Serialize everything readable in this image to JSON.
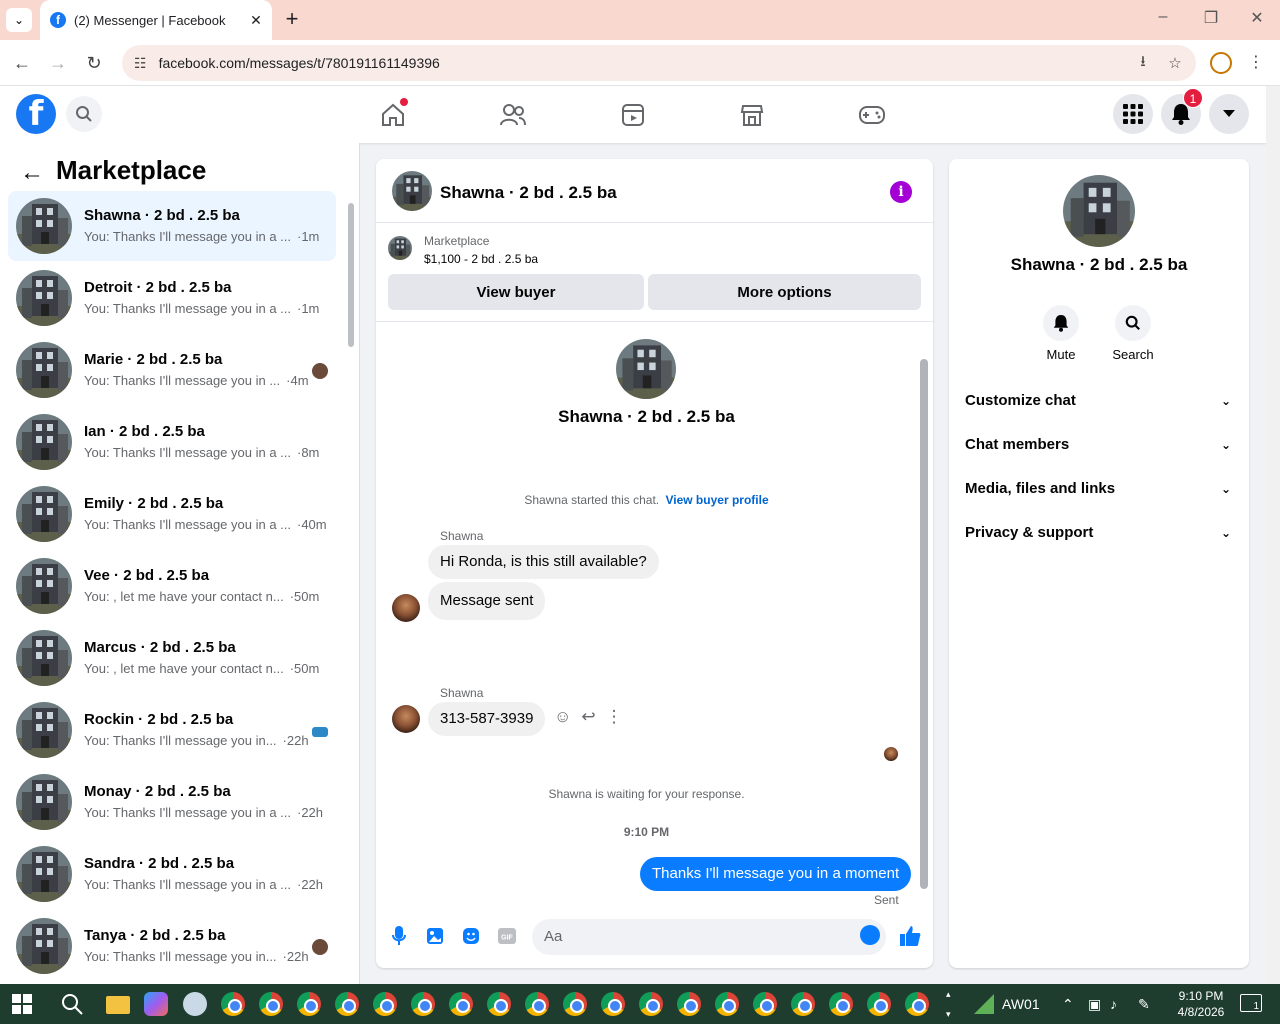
{
  "browser": {
    "tab_title": "(2) Messenger | Facebook",
    "favicon_letter": "f",
    "url": "facebook.com/messages/t/780191161149396"
  },
  "header": {
    "notification_count": "1",
    "logo_letter": "f"
  },
  "sidebar": {
    "title": "Marketplace",
    "conversations": [
      {
        "name": "Shawna · 2 bd . 2.5 ba",
        "snippet": "You: Thanks I'll message you in a ...",
        "time": "·1m",
        "active": true
      },
      {
        "name": "Detroit · 2 bd . 2.5 ba",
        "snippet": "You: Thanks I'll message you in a ...",
        "time": "·1m"
      },
      {
        "name": "Marie · 2 bd . 2.5 ba",
        "snippet": "You: Thanks I'll message you in ...",
        "time": "·4m"
      },
      {
        "name": "Ian · 2 bd . 2.5 ba",
        "snippet": "You: Thanks I'll message you in a ...",
        "time": "·8m"
      },
      {
        "name": "Emily · 2 bd . 2.5 ba",
        "snippet": "You: Thanks I'll message you in a ...",
        "time": "·40m"
      },
      {
        "name": "Vee · 2 bd . 2.5 ba",
        "snippet": "You: , let me have your contact n...",
        "time": "·50m"
      },
      {
        "name": "Marcus · 2 bd . 2.5 ba",
        "snippet": "You: , let me have your contact n...",
        "time": "·50m"
      },
      {
        "name": "Rockin · 2 bd . 2.5 ba",
        "snippet": "You: Thanks I'll message you in...",
        "time": "·22h"
      },
      {
        "name": "Monay · 2 bd . 2.5 ba",
        "snippet": "You: Thanks I'll message you in a ...",
        "time": "·22h"
      },
      {
        "name": "Sandra · 2 bd . 2.5 ba",
        "snippet": "You: Thanks I'll message you in a ...",
        "time": "·22h"
      },
      {
        "name": "Tanya · 2 bd . 2.5 ba",
        "snippet": "You: Thanks I'll message you in...",
        "time": "·22h"
      }
    ]
  },
  "chat": {
    "title": "Shawna · 2 bd . 2.5 ba",
    "info_letter": "i",
    "marketplace_label": "Marketplace",
    "listing": "$1,100 - 2 bd . 2.5 ba",
    "view_buyer": "View buyer",
    "more_options": "More options",
    "started_text": "Shawna started this chat.",
    "view_buyer_profile": "View buyer profile",
    "sender1": "Shawna",
    "msg1": "Hi Ronda, is this still available?",
    "msg2": "Message sent",
    "sender2": "Shawna",
    "msg3": "313-587-3939",
    "waiting": "Shawna is waiting for your response.",
    "timestamp": "9:10 PM",
    "my_msg": "Thanks I'll message you in a moment",
    "sent_status": "Sent",
    "input_placeholder": "Aa"
  },
  "details": {
    "name": "Shawna · 2 bd . 2.5 ba",
    "mute_label": "Mute",
    "search_label": "Search",
    "rows": [
      "Customize chat",
      "Chat members",
      "Media, files and links",
      "Privacy & support"
    ]
  },
  "taskbar": {
    "network_label": "AW01",
    "time": "9:10 PM",
    "date": "4/8/2026",
    "notif_count": "1"
  },
  "colors": {
    "fb_blue": "#1877f2",
    "msg_blue": "#0a7cff",
    "active_row": "#ebf5ff",
    "info_purple": "#a400d6"
  }
}
